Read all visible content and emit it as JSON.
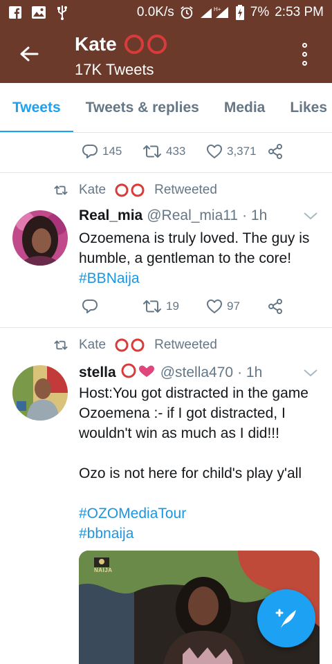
{
  "status_bar": {
    "net_speed": "0.0K/s",
    "battery": "7%",
    "time": "2:53 PM",
    "icons": [
      "facebook-icon",
      "gallery-icon",
      "usb-icon",
      "alarm-icon",
      "signal-icon",
      "battery-charging-icon"
    ]
  },
  "header": {
    "name": "Kate",
    "tweet_count": "17K Tweets",
    "background": "#6b3a2b"
  },
  "tabs": [
    {
      "label": "Tweets",
      "active": true
    },
    {
      "label": "Tweets & replies",
      "active": false
    },
    {
      "label": "Media",
      "active": false
    },
    {
      "label": "Likes",
      "active": false
    }
  ],
  "tweet0": {
    "replies": "145",
    "retweets": "433",
    "likes": "3,371"
  },
  "tweet1": {
    "retweeted_by": "Kate",
    "retweeted_label": "Retweeted",
    "name": "Real_mia",
    "handle": "@Real_mia11",
    "time": "· 1h",
    "text_lines": [
      "Ozoemena is truly loved. The guy is",
      "humble, a gentleman to the core!"
    ],
    "hashtag": "#BBNaija",
    "retweets": "19",
    "likes": "97"
  },
  "tweet2": {
    "retweeted_by": "Kate",
    "retweeted_label": "Retweeted",
    "name": "stella",
    "handle": "@stella470",
    "time": "· 1h",
    "text_lines": [
      "Host:You got distracted in the game",
      "Ozoemena :- if I got distracted, I",
      "wouldn't win as much as I did!!!"
    ],
    "line2": "Ozo is not here for child's play y'all",
    "hashtags": [
      "#OZOMediaTour",
      "#bbnaija"
    ],
    "media_watermark": "NAIJA"
  },
  "colors": {
    "accent": "#1da1f2",
    "ring_red": "#d93a3a",
    "muted": "#657786"
  }
}
